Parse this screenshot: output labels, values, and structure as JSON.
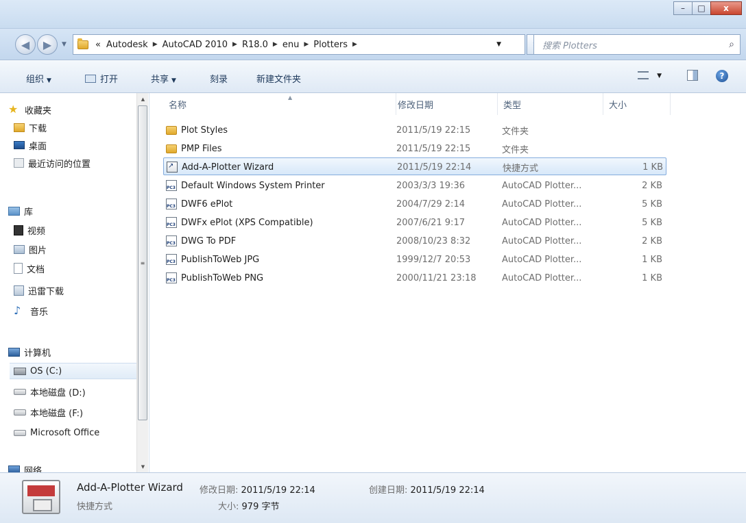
{
  "window": {
    "minimize": "–",
    "maximize": "□",
    "close": "x"
  },
  "nav": {
    "back": "◀",
    "forward": "▶"
  },
  "address": {
    "prefix": "«",
    "crumbs": [
      "Autodesk",
      "AutoCAD 2010",
      "R18.0",
      "enu",
      "Plotters"
    ],
    "search_placeholder": "搜索 Plotters"
  },
  "toolbar": {
    "organize": "组织",
    "open": "打开",
    "share": "共享",
    "burn": "刻录",
    "new_folder": "新建文件夹"
  },
  "sidebar": {
    "favorites": {
      "label": "收藏夹",
      "items": [
        "下载",
        "桌面",
        "最近访问的位置"
      ]
    },
    "libraries": {
      "label": "库",
      "items": [
        "视频",
        "图片",
        "文档",
        "迅雷下载",
        "音乐"
      ]
    },
    "computer": {
      "label": "计算机",
      "items": [
        "OS (C:)",
        "本地磁盘 (D:)",
        "本地磁盘 (F:)",
        "Microsoft Office"
      ]
    },
    "network": {
      "label": "网络"
    }
  },
  "columns": {
    "name": "名称",
    "date": "修改日期",
    "type": "类型",
    "size": "大小"
  },
  "files": [
    {
      "name": "Plot Styles",
      "date": "2011/5/19 22:15",
      "type": "文件夹",
      "size": "",
      "icon": "folder-icon"
    },
    {
      "name": "PMP Files",
      "date": "2011/5/19 22:15",
      "type": "文件夹",
      "size": "",
      "icon": "folder-icon"
    },
    {
      "name": "Add-A-Plotter Wizard",
      "date": "2011/5/19 22:14",
      "type": "快捷方式",
      "size": "1 KB",
      "icon": "shortcut-icon"
    },
    {
      "name": "Default Windows System Printer",
      "date": "2003/3/3 19:36",
      "type": "AutoCAD Plotter...",
      "size": "2 KB",
      "icon": "pc3-icon"
    },
    {
      "name": "DWF6 ePlot",
      "date": "2004/7/29 2:14",
      "type": "AutoCAD Plotter...",
      "size": "5 KB",
      "icon": "pc3-icon"
    },
    {
      "name": "DWFx ePlot (XPS Compatible)",
      "date": "2007/6/21 9:17",
      "type": "AutoCAD Plotter...",
      "size": "5 KB",
      "icon": "pc3-icon"
    },
    {
      "name": "DWG To PDF",
      "date": "2008/10/23 8:32",
      "type": "AutoCAD Plotter...",
      "size": "2 KB",
      "icon": "pc3-icon"
    },
    {
      "name": "PublishToWeb JPG",
      "date": "1999/12/7 20:53",
      "type": "AutoCAD Plotter...",
      "size": "1 KB",
      "icon": "pc3-icon"
    },
    {
      "name": "PublishToWeb PNG",
      "date": "2000/11/21 23:18",
      "type": "AutoCAD Plotter...",
      "size": "1 KB",
      "icon": "pc3-icon"
    }
  ],
  "details": {
    "title": "Add-A-Plotter Wizard",
    "modified_label": "修改日期:",
    "modified_value": "2011/5/19 22:14",
    "created_label": "创建日期:",
    "created_value": "2011/5/19 22:14",
    "type": "快捷方式",
    "size_label": "大小:",
    "size_value": "979 字节"
  }
}
